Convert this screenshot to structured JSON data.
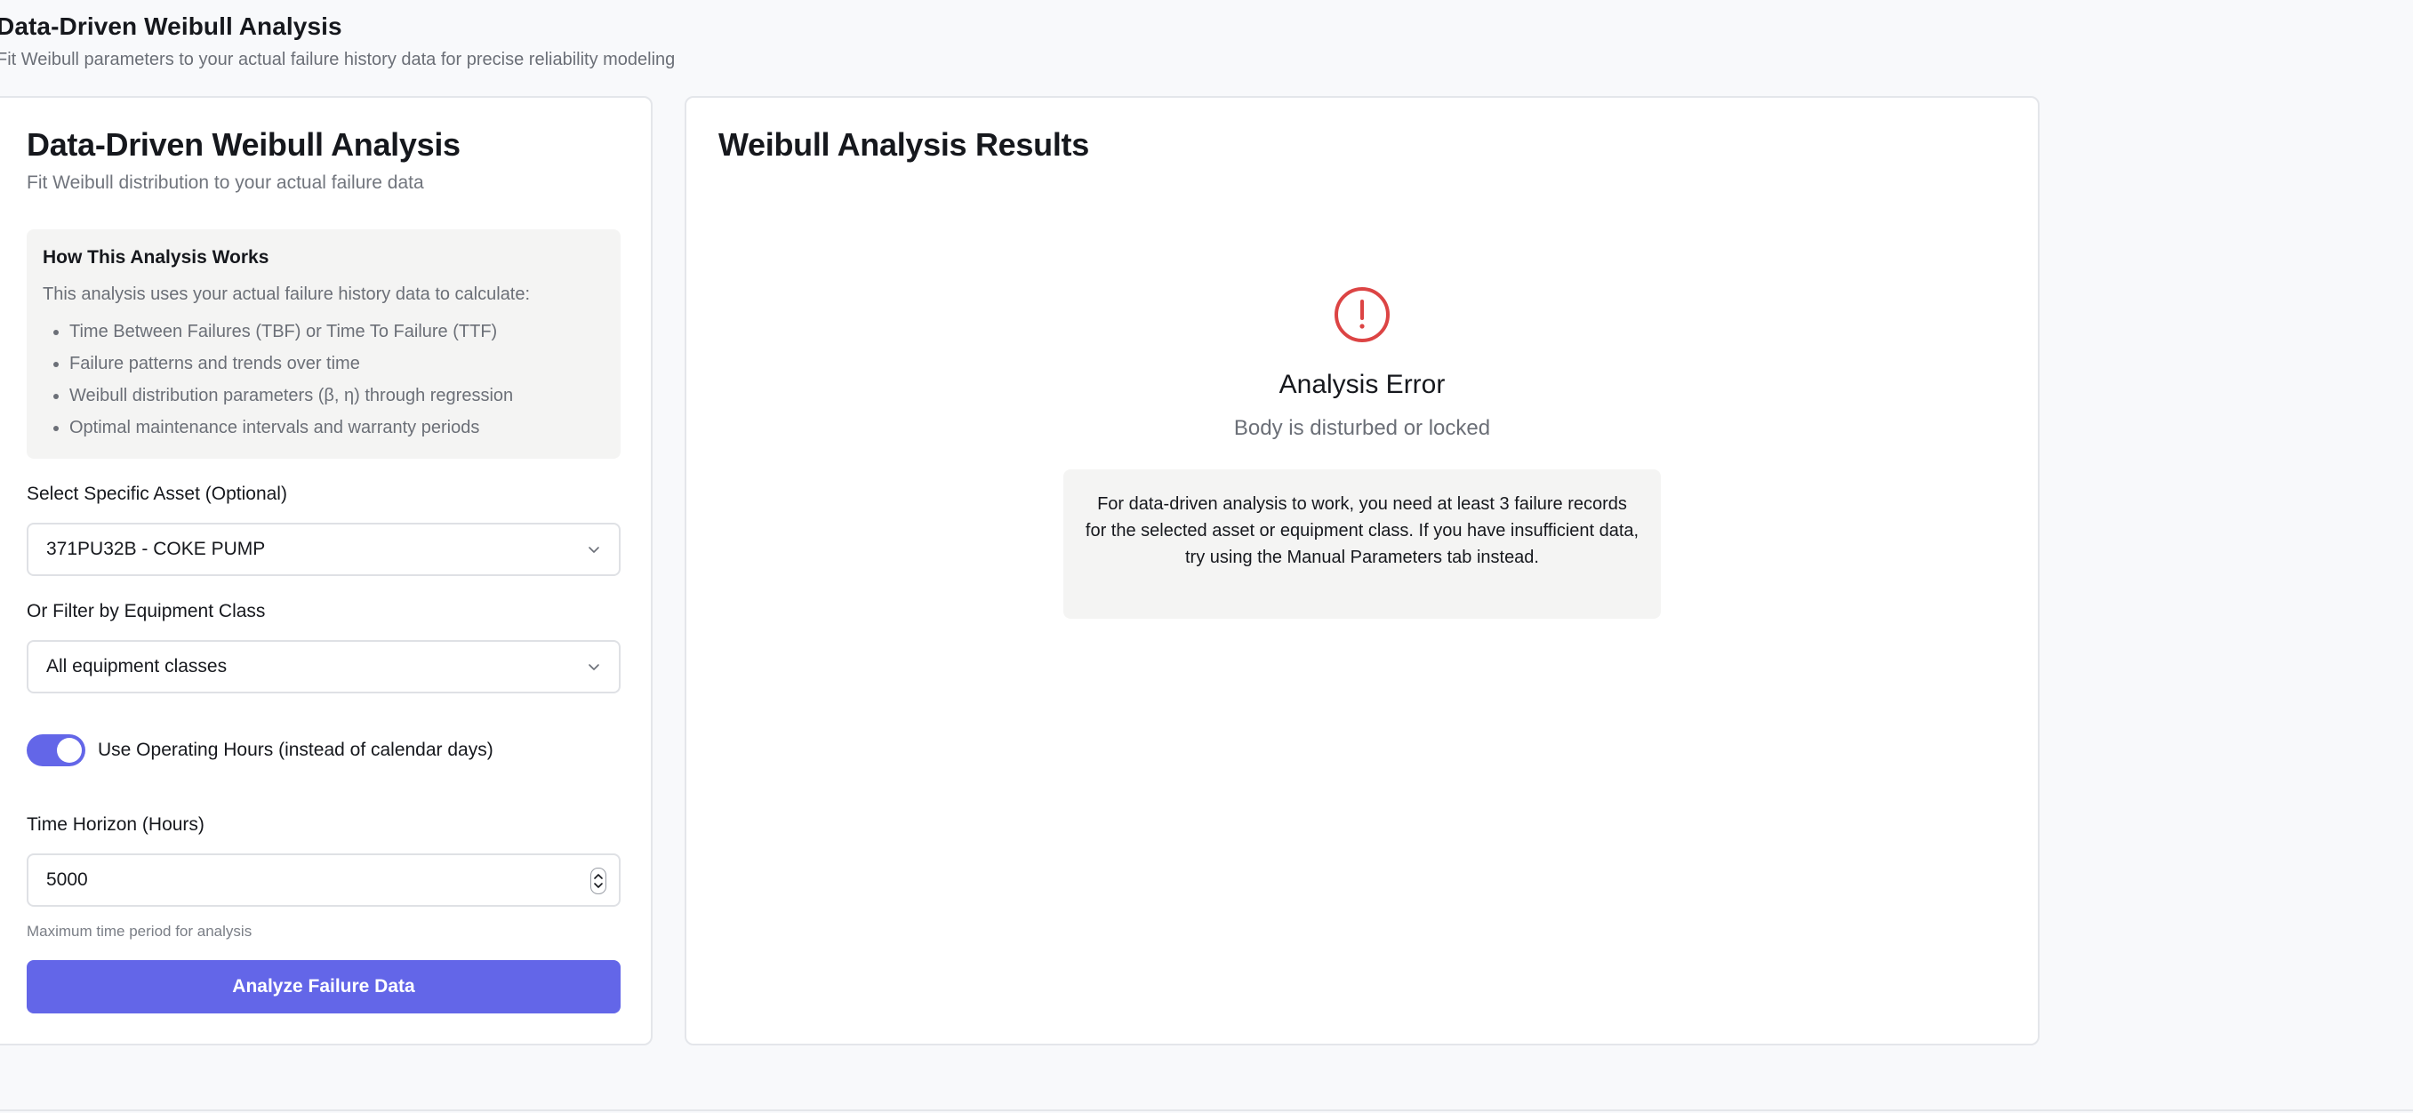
{
  "page": {
    "title": "Data-Driven Weibull Analysis",
    "subtitle": "Fit Weibull parameters to your actual failure history data for precise reliability modeling"
  },
  "left_panel": {
    "title": "Data-Driven Weibull Analysis",
    "subtitle": "Fit Weibull distribution to your actual failure data",
    "info": {
      "title": "How This Analysis Works",
      "text": "This analysis uses your actual failure history data to calculate:",
      "items": [
        "Time Between Failures (TBF) or Time To Failure (TTF)",
        "Failure patterns and trends over time",
        "Weibull distribution parameters (β, η) through regression",
        "Optimal maintenance intervals and warranty periods"
      ]
    },
    "asset_select": {
      "label": "Select Specific Asset (Optional)",
      "value": "371PU32B - COKE PUMP"
    },
    "class_select": {
      "label": "Or Filter by Equipment Class",
      "value": "All equipment classes"
    },
    "operating_hours_toggle": {
      "label": "Use Operating Hours (instead of calendar days)",
      "checked": true
    },
    "time_horizon": {
      "label": "Time Horizon (Hours)",
      "value": "5000",
      "hint": "Maximum time period for analysis"
    },
    "analyze_button": "Analyze Failure Data"
  },
  "right_panel": {
    "title": "Weibull Analysis Results",
    "error": {
      "icon": "alert-circle-icon",
      "title": "Analysis Error",
      "message": "Body is disturbed or locked",
      "help": "For data-driven analysis to work, you need at least 3 failure records for the selected asset or equipment class. If you have insufficient data, try using the Manual Parameters tab instead."
    }
  },
  "colors": {
    "accent": "#6366e8",
    "error": "#dc4444",
    "background": "#f8f9fb",
    "panel": "#ffffff"
  }
}
